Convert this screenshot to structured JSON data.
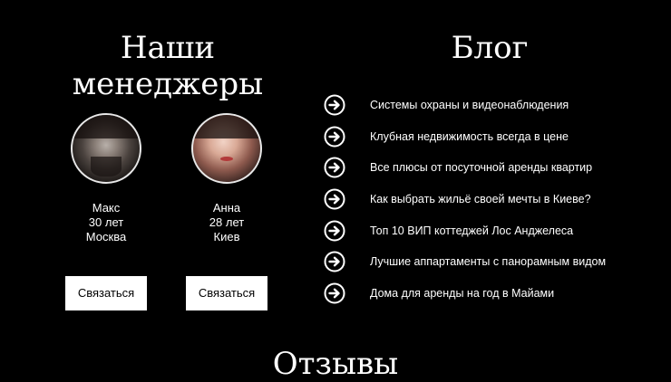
{
  "managers_section": {
    "title_line1": "Наши",
    "title_line2": "менеджеры",
    "managers": [
      {
        "name": "Макс",
        "age": "30 лет",
        "city": "Москва",
        "button": "Связаться"
      },
      {
        "name": "Анна",
        "age": "28 лет",
        "city": "Киев",
        "button": "Связаться"
      }
    ]
  },
  "blog_section": {
    "title": "Блог",
    "icon": "arrow-right-circle-icon",
    "posts": [
      "Системы охраны и видеонаблюдения",
      "Клубная недвижимость всегда в цене",
      "Все плюсы от посуточной аренды квартир",
      "Как выбрать жильё своей мечты в Киеве?",
      "Топ 10 ВИП коттеджей Лос Анджелеса",
      "Лучшие аппартаменты с панорамным видом",
      "Дома для аренды на год в Майами"
    ]
  },
  "reviews_section": {
    "title": "Отзывы"
  },
  "colors": {
    "background": "#000000",
    "text": "#ffffff",
    "button_bg": "#ffffff",
    "button_text": "#000000"
  }
}
